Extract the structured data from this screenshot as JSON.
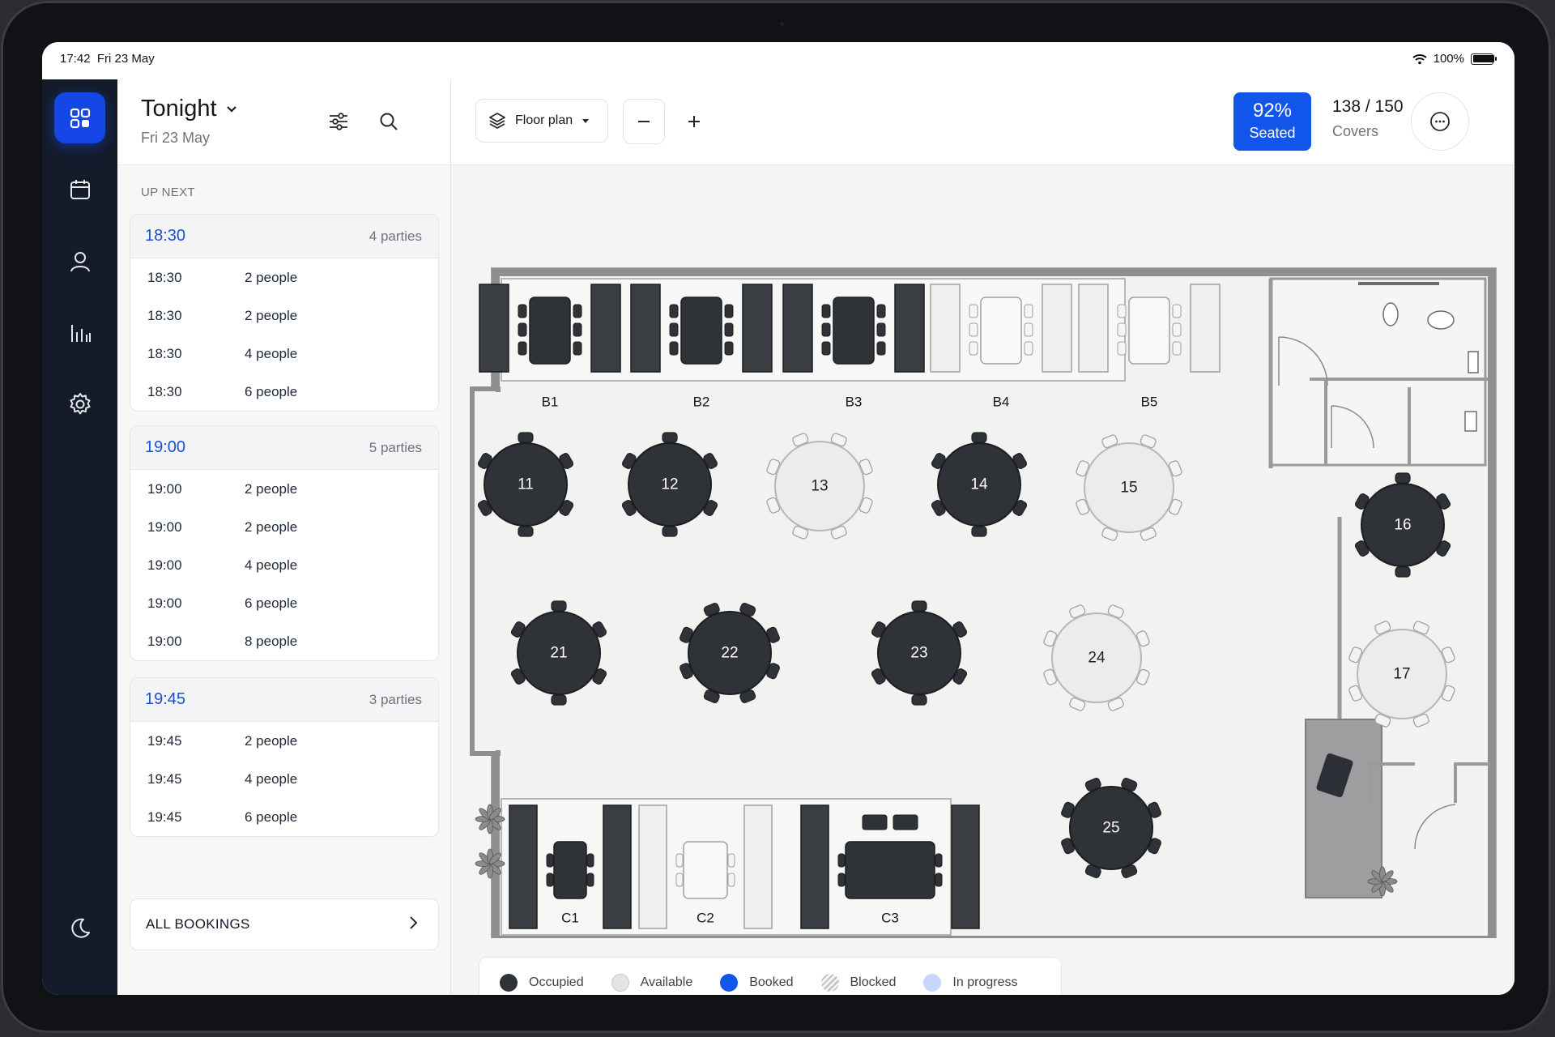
{
  "status": {
    "time": "17:42",
    "date": "Fri 23 May",
    "battery": "100%",
    "battery_level": 1.0
  },
  "rail": [
    "dashboard-icon",
    "calendar-icon",
    "user-icon",
    "analytics-icon",
    "settings-icon",
    "moon-icon"
  ],
  "panel": {
    "title": "Tonight",
    "subtitle": "Fri 23 May",
    "upnext_label": "UP NEXT",
    "groups": [
      {
        "time": "18:30",
        "count": "4 parties",
        "rows": [
          {
            "time": "18:30",
            "people": "2 people"
          },
          {
            "time": "18:30",
            "people": "2 people"
          },
          {
            "time": "18:30",
            "people": "4 people"
          },
          {
            "time": "18:30",
            "people": "6 people"
          }
        ]
      },
      {
        "time": "19:00",
        "count": "5 parties",
        "rows": [
          {
            "time": "19:00",
            "people": "2 people"
          },
          {
            "time": "19:00",
            "people": "2 people"
          },
          {
            "time": "19:00",
            "people": "4 people"
          },
          {
            "time": "19:00",
            "people": "6 people"
          },
          {
            "time": "19:00",
            "people": "8 people"
          }
        ]
      },
      {
        "time": "19:45",
        "count": "3 parties",
        "rows": [
          {
            "time": "19:45",
            "people": "2 people"
          },
          {
            "time": "19:45",
            "people": "4 people"
          },
          {
            "time": "19:45",
            "people": "6 people"
          }
        ]
      }
    ],
    "all_bookings": "ALL BOOKINGS"
  },
  "toolbar": {
    "floorplan_label": "Floor plan",
    "seated_value": "92%",
    "seated_label": "Seated",
    "covers_value": "138 / 150",
    "covers_label": "Covers"
  },
  "colors": {
    "accent": "#1155ea",
    "occupied": "#2f3237",
    "available": "#ececec",
    "rail": "#141c2b"
  },
  "tables": {
    "booths": [
      {
        "label": "B1",
        "status": "occupied"
      },
      {
        "label": "B2",
        "status": "occupied"
      },
      {
        "label": "B3",
        "status": "occupied"
      },
      {
        "label": "B4",
        "status": "available"
      },
      {
        "label": "B5",
        "status": "available"
      }
    ],
    "rounds": [
      {
        "label": "11",
        "status": "occupied"
      },
      {
        "label": "12",
        "status": "occupied"
      },
      {
        "label": "13",
        "status": "available"
      },
      {
        "label": "14",
        "status": "occupied"
      },
      {
        "label": "15",
        "status": "available"
      },
      {
        "label": "16",
        "status": "occupied"
      },
      {
        "label": "21",
        "status": "occupied"
      },
      {
        "label": "22",
        "status": "occupied"
      },
      {
        "label": "23",
        "status": "occupied"
      },
      {
        "label": "24",
        "status": "available"
      },
      {
        "label": "17",
        "status": "available"
      },
      {
        "label": "25",
        "status": "occupied"
      }
    ],
    "bottom_booths": [
      {
        "label": "C1",
        "status": "occupied"
      },
      {
        "label": "C2",
        "status": "available"
      },
      {
        "label": "C3",
        "status": "occupied"
      }
    ]
  },
  "legend": [
    {
      "label": "Occupied",
      "color": "#2f3237"
    },
    {
      "label": "Available",
      "color": "#e4e4e7"
    },
    {
      "label": "Booked",
      "color": "#1155ea"
    },
    {
      "label": "Blocked",
      "color": "hatched"
    },
    {
      "label": "In progress",
      "color": "#c7d6fb"
    }
  ]
}
